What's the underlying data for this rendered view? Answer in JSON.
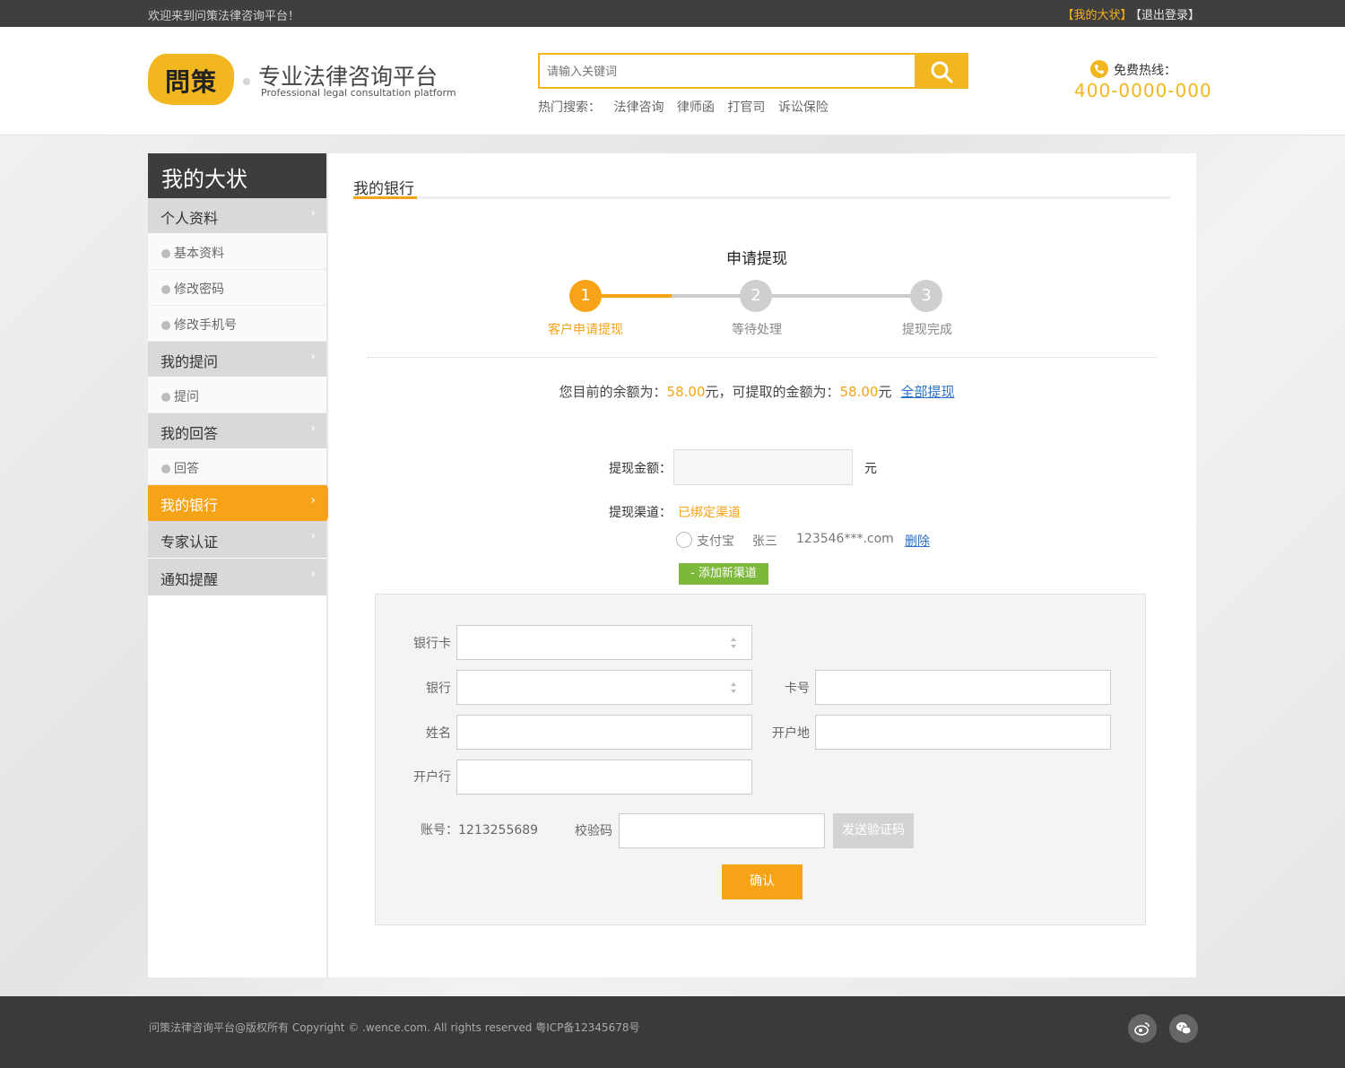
{
  "topbar": {
    "welcome": "欢迎来到问策法律咨询平台！",
    "my_link": "【我的大状】",
    "logout_link": "【退出登录】"
  },
  "header": {
    "logo_text": "問策",
    "title": "专业法律咨询平台",
    "subtitle": "Professional legal consultation platform",
    "search_placeholder": "请输入关键词",
    "hot_label": "热门搜索：",
    "hot_items": [
      "法律咨询",
      "律师函",
      "打官司",
      "诉讼保险"
    ],
    "hotline_label": "免费热线：",
    "hotline_number": "400-0000-000",
    "accent_color": "#f2b71e"
  },
  "sidebar": {
    "title": "我的大状",
    "items": [
      {
        "type": "group",
        "label": "个人资料"
      },
      {
        "type": "sub",
        "label": "基本资料"
      },
      {
        "type": "sub",
        "label": "修改密码"
      },
      {
        "type": "sub",
        "label": "修改手机号"
      },
      {
        "type": "group",
        "label": "我的提问"
      },
      {
        "type": "sub",
        "label": "提问"
      },
      {
        "type": "group",
        "label": "我的回答"
      },
      {
        "type": "sub",
        "label": "回答"
      },
      {
        "type": "active",
        "label": "我的银行"
      },
      {
        "type": "group",
        "label": "专家认证"
      },
      {
        "type": "group",
        "label": "通知提醒"
      }
    ],
    "chevron": "›"
  },
  "main": {
    "tab_title": "我的银行",
    "apply_title": "申请提现",
    "steps": [
      {
        "num": "1",
        "label": "客户申请提现",
        "state": "on"
      },
      {
        "num": "2",
        "label": "等待处理",
        "state": "off"
      },
      {
        "num": "3",
        "label": "提现完成",
        "state": "off"
      }
    ],
    "balance_prefix": "您目前的余额为：",
    "balance_value": "58.00",
    "balance_mid": "元，可提取的金额为：",
    "withdrawable_value": "58.00",
    "balance_suffix": "元",
    "withdraw_all": "全部提现",
    "amount_label": "提现金额：",
    "amount_unit": "元",
    "channel_label": "提现渠道：",
    "bound_channels": "已绑定渠道",
    "channel": {
      "type": "支付宝",
      "name": "张三",
      "account": "123546***.com",
      "delete": "删除"
    },
    "add_channel": "- 添加新渠道",
    "form": {
      "bank_card_label": "银行卡",
      "bank_label": "银行",
      "card_no_label": "卡号",
      "name_label": "姓名",
      "open_place_label": "开户地",
      "open_bank_label": "开户行",
      "account_text": "账号：1213255689",
      "code_label": "校验码",
      "send_code": "发送验证码",
      "confirm": "确认"
    },
    "accent_color": "#f6a317",
    "add_color": "#7cb83a"
  },
  "footer": {
    "copyright": "问策法律咨询平台@版权所有  Copyright © .wence.com. All rights reserved  粤ICP备12345678号",
    "icons": [
      "weibo-icon",
      "wechat-icon"
    ]
  }
}
